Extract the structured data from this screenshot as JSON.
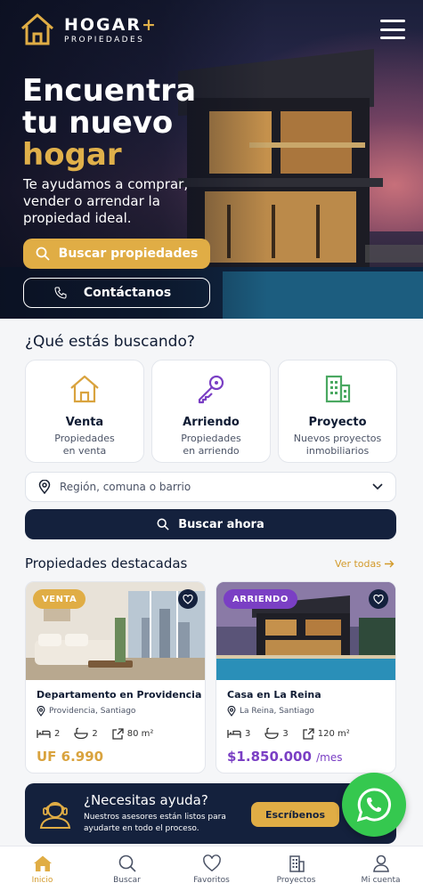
{
  "brand": {
    "name": "HOGAR",
    "plus": "+",
    "tagline": "PROPIEDADES"
  },
  "hero": {
    "title_line1": "Encuentra",
    "title_line2": "tu nuevo",
    "title_line3": "hogar",
    "subtitle": "Te ayudamos a comprar, vender o arrendar la propiedad ideal.",
    "primary_cta": "Buscar propiedades",
    "secondary_cta": "Contáctanos"
  },
  "search": {
    "title": "¿Qué estás buscando?",
    "categories": [
      {
        "title": "Venta",
        "desc_line1": "Propiedades",
        "desc_line2": "en venta",
        "icon": "house-icon"
      },
      {
        "title": "Arriendo",
        "desc_line1": "Propiedades",
        "desc_line2": "en arriendo",
        "icon": "key-icon"
      },
      {
        "title": "Proyecto",
        "desc_line1": "Nuevos proyectos",
        "desc_line2": "inmobiliarios",
        "icon": "building-icon"
      }
    ],
    "region_placeholder": "Región, comuna o barrio",
    "submit": "Buscar ahora"
  },
  "featured": {
    "title": "Propiedades destacadas",
    "see_all": "Ver todas",
    "items": [
      {
        "badge": "VENTA",
        "name": "Departamento en Providencia",
        "location": "Providencia, Santiago",
        "beds": "2",
        "baths": "2",
        "area": "80 m²",
        "price": "UF 6.990",
        "price_suffix": ""
      },
      {
        "badge": "ARRIENDO",
        "name": "Casa en La Reina",
        "location": "La Reina, Santiago",
        "beds": "3",
        "baths": "3",
        "area": "120 m²",
        "price": "$1.850.000",
        "price_suffix": "/mes"
      }
    ]
  },
  "help": {
    "title": "¿Necesitas ayuda?",
    "desc": "Nuestros asesores están listos para ayudarte en todo el proceso.",
    "cta": "Escríbenos"
  },
  "nav": {
    "items": [
      "Inicio",
      "Buscar",
      "Favoritos",
      "Proyectos",
      "Mi cuenta"
    ]
  },
  "colors": {
    "gold": "#e0ad45",
    "navy": "#14213d",
    "purple": "#7a3fc4",
    "whatsapp": "#35c84f"
  }
}
